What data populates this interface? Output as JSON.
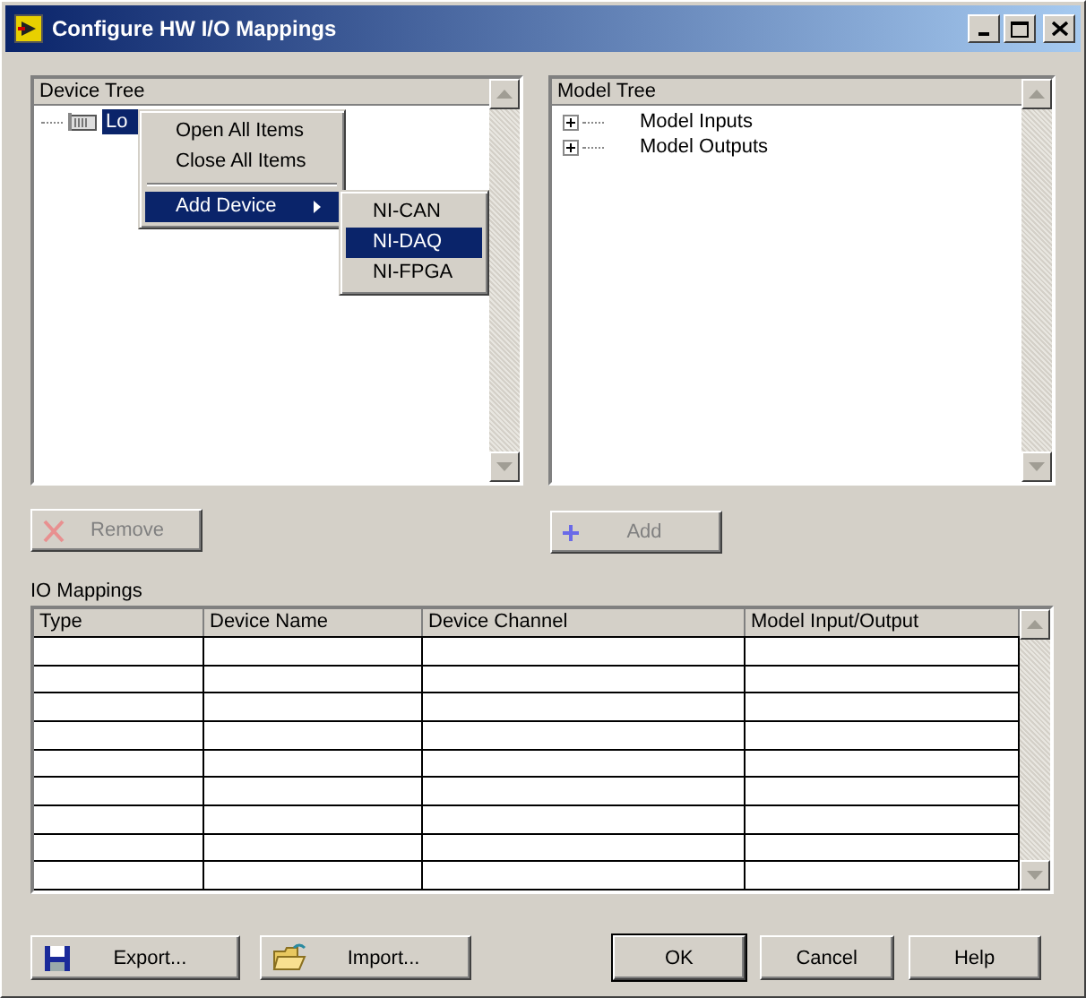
{
  "window": {
    "title": "Configure HW I/O Mappings"
  },
  "device_tree": {
    "heading": "Device Tree",
    "items": [
      {
        "label": "Lo",
        "selected": true
      }
    ]
  },
  "context_menu": {
    "items": [
      {
        "kind": "item",
        "label": "Open All Items",
        "selected": false
      },
      {
        "kind": "item",
        "label": "Close All Items",
        "selected": false
      },
      {
        "kind": "separator"
      },
      {
        "kind": "submenu",
        "label": "Add Device",
        "selected": true
      }
    ],
    "submenu": [
      {
        "label": "NI-CAN",
        "selected": false
      },
      {
        "label": "NI-DAQ",
        "selected": true
      },
      {
        "label": "NI-FPGA",
        "selected": false
      }
    ]
  },
  "model_tree": {
    "heading": "Model Tree",
    "items": [
      {
        "label": "Model Inputs",
        "expanded": false
      },
      {
        "label": "Model Outputs",
        "expanded": false
      }
    ]
  },
  "remove_button": {
    "label": "Remove",
    "disabled": true
  },
  "add_button": {
    "label": "Add",
    "disabled": true
  },
  "io_mappings": {
    "label": "IO Mappings",
    "columns": [
      "Type",
      "Device Name",
      "Device Channel",
      "Model Input/Output"
    ]
  },
  "footer_buttons": [
    {
      "kind": "export",
      "label": "Export...",
      "default": false
    },
    {
      "kind": "import",
      "label": "Import...",
      "default": false
    },
    {
      "kind": "plain",
      "label": "OK",
      "default": true
    },
    {
      "kind": "plain",
      "label": "Cancel",
      "default": false
    },
    {
      "kind": "plain",
      "label": "Help",
      "default": false
    }
  ]
}
